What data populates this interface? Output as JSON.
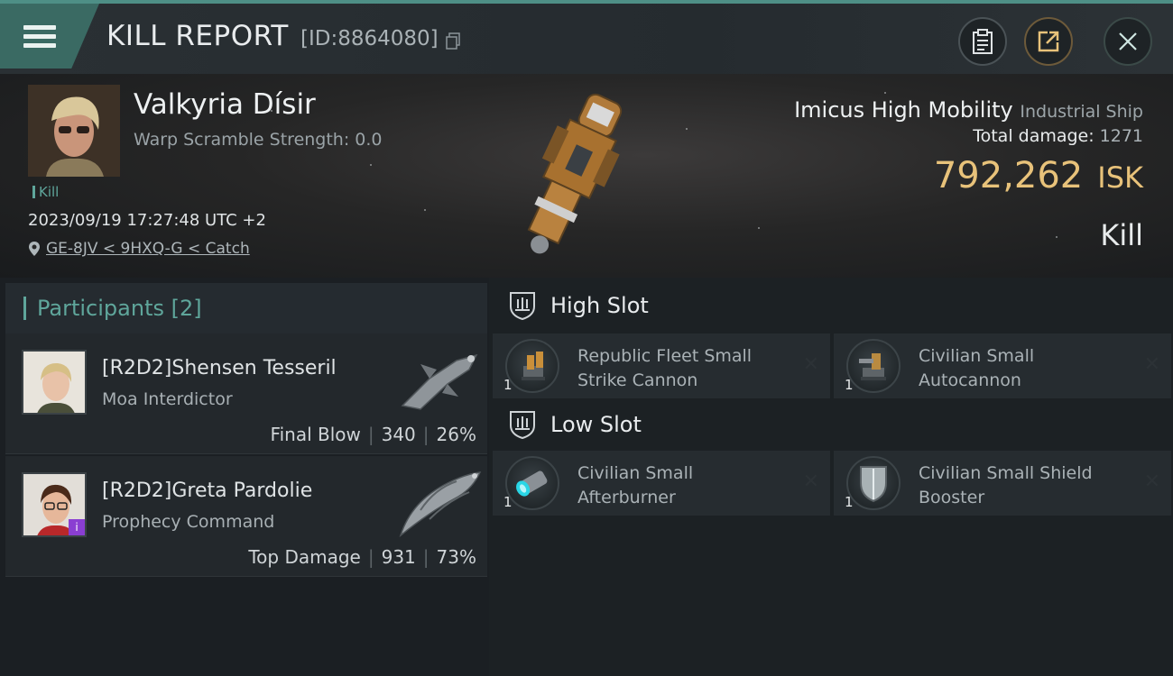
{
  "header": {
    "title": "KILL REPORT",
    "report_id": "[ID:8864080]"
  },
  "victim": {
    "name": "Valkyria Dísir",
    "warp_scramble": "Warp Scramble Strength: 0.0",
    "kill_tag": "Kill",
    "datetime": "2023/09/19 17:27:48 UTC +2",
    "location": "GE-8JV < 9HXQ-G < Catch",
    "ship_name": "Imicus High Mobility",
    "ship_class": "Industrial Ship",
    "total_damage_label": "Total damage:",
    "total_damage": "1271",
    "isk_value": "792,262",
    "isk_unit": "ISK",
    "result": "Kill"
  },
  "participants": {
    "label": "Participants [2]",
    "items": [
      {
        "name": "[R2D2]Shensen Tesseril",
        "ship": "Moa Interdictor",
        "role": "Final Blow",
        "damage": "340",
        "percent": "26%"
      },
      {
        "name": "[R2D2]Greta Pardolie",
        "ship": "Prophecy Command",
        "role": "Top Damage",
        "damage": "931",
        "percent": "73%",
        "badge": "i"
      }
    ]
  },
  "slots": {
    "high": {
      "label": "High Slot",
      "modules": [
        {
          "line1": "Republic Fleet Small",
          "line2": "Strike Cannon",
          "qty": "1"
        },
        {
          "line1": "Civilian Small",
          "line2": "Autocannon",
          "qty": "1"
        }
      ]
    },
    "low": {
      "label": "Low Slot",
      "modules": [
        {
          "line1": "Civilian Small",
          "line2": "Afterburner",
          "qty": "1"
        },
        {
          "line1": "Civilian Small Shield",
          "line2": "Booster",
          "qty": "1"
        }
      ]
    }
  },
  "colors": {
    "accent": "#5fa69b",
    "isk": "#e8c27a",
    "badge": "#8a3ed2"
  }
}
